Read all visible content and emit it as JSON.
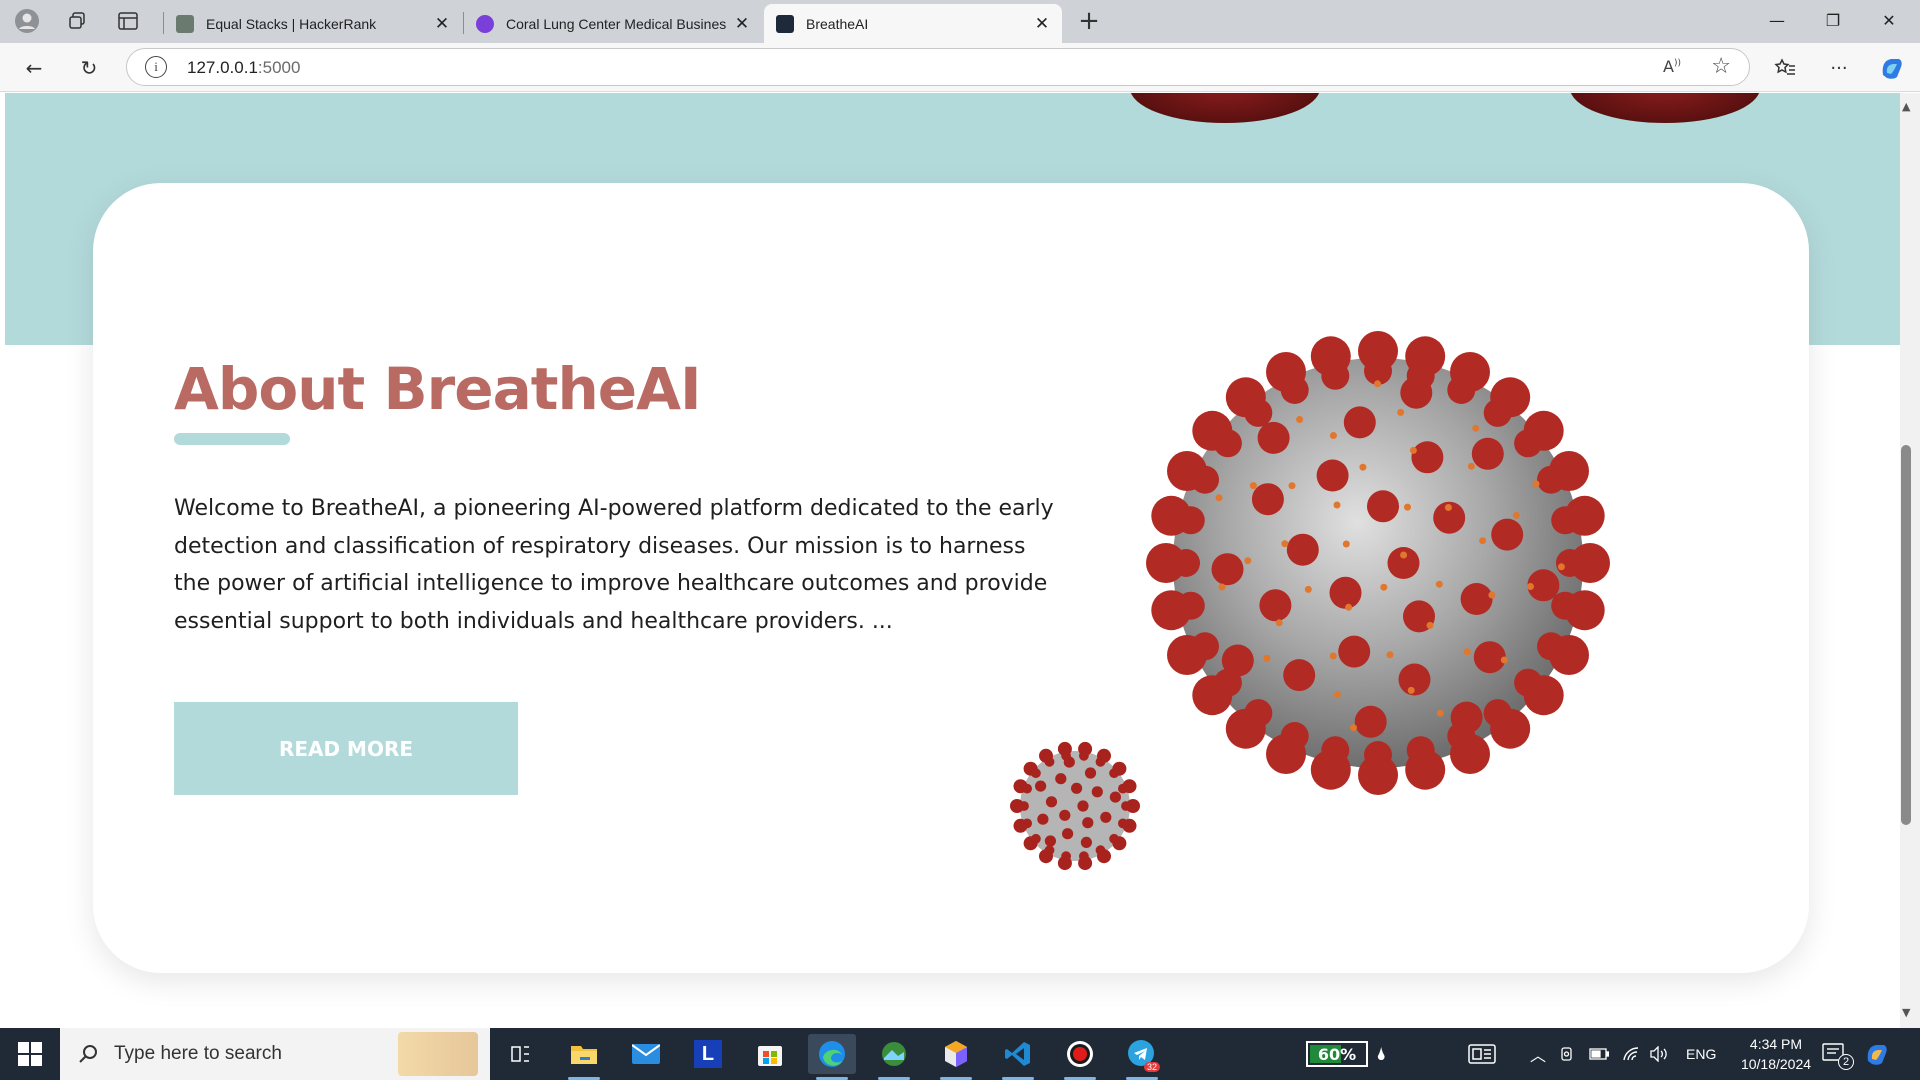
{
  "browser": {
    "tabs": [
      {
        "title": "Equal Stacks | HackerRank",
        "fav_color": "#6b7a6f",
        "active": false
      },
      {
        "title": "Coral Lung Center Medical Business",
        "fav_color": "#7b3fd9",
        "active": false
      },
      {
        "title": "BreatheAI",
        "fav_color": "#1e2a3a",
        "active": true
      }
    ],
    "url_host": "127.0.0.1",
    "url_port": ":5000"
  },
  "about": {
    "title": "About BreatheAI",
    "body": "Welcome to BreatheAI, a pioneering AI-powered platform dedicated to the early detection and classification of respiratory diseases. Our mission is to harness the power of artificial intelligence to improve healthcare outcomes and provide essential support to both individuals and healthcare providers. ...",
    "button": "READ MORE"
  },
  "colors": {
    "accent_teal": "#b3dadb",
    "title": "#b96a63"
  },
  "taskbar": {
    "search_placeholder": "Type here to search",
    "battery": "60%",
    "battery_level": 0.6,
    "lang": "ENG",
    "time": "4:34 PM",
    "date": "10/18/2024",
    "telegram_badge": "32",
    "notif_count": "2"
  }
}
